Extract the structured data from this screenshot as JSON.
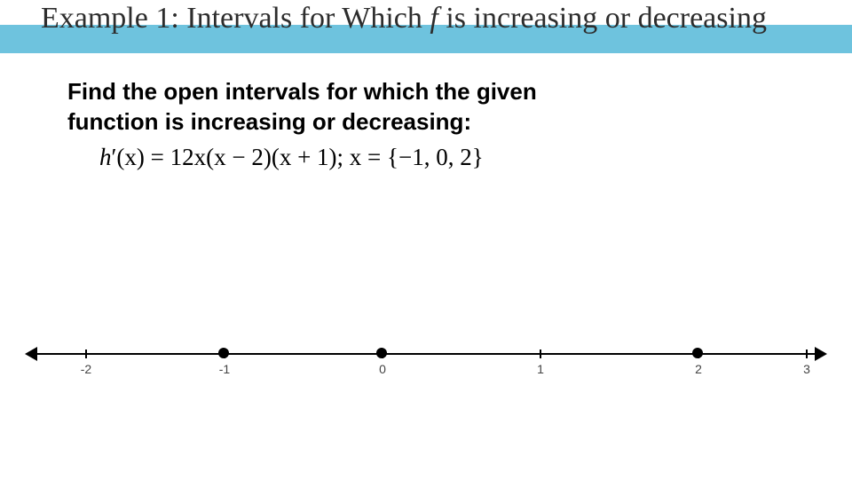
{
  "title": {
    "pre": "Example 1: Intervals for Which ",
    "var": "f ",
    "post": "is increasing or decreasing"
  },
  "prompt": {
    "line1": "Find the open intervals for which the given",
    "line2": "function is increasing or decreasing:"
  },
  "equation": {
    "lhs_h": "h",
    "lhs_prime": "′",
    "lhs_paren": "(x) = ",
    "rhs": "12x(x − 2)(x + 1); x = {−1, 0, 2}"
  },
  "numberline": {
    "ticks": {
      "t_neg2": "-2",
      "t_neg1": "-1",
      "t_0": "0",
      "t_1": "1",
      "t_2": "2",
      "t_3": "3"
    },
    "critical_points": [
      -1,
      0,
      2
    ]
  }
}
